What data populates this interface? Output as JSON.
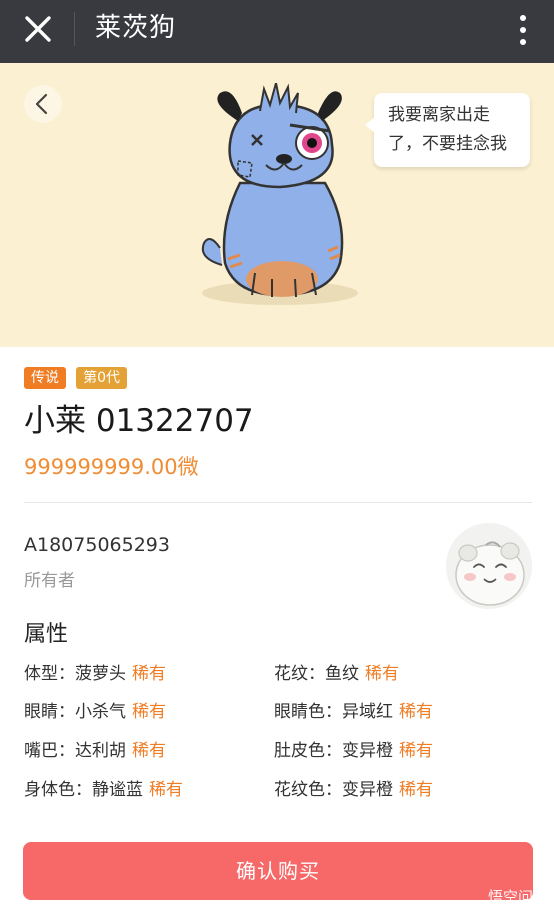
{
  "appbar": {
    "title": "莱茨狗",
    "close_icon": "close-icon",
    "more_icon": "more-vertical-icon"
  },
  "hero": {
    "bubble_text": "我要离家出走了，不要挂念我",
    "back_icon": "chevron-left-icon"
  },
  "pet": {
    "badges": [
      "传说",
      "第0代"
    ],
    "name": "小莱 01322707",
    "price": "999999999.00微"
  },
  "owner": {
    "id": "A18075065293",
    "label": "所有者"
  },
  "attributes": {
    "title": "属性",
    "rare_label": "稀有",
    "items": [
      {
        "label": "体型：菠萝头",
        "tag": "稀有"
      },
      {
        "label": "花纹：鱼纹",
        "tag": "稀有"
      },
      {
        "label": "眼睛：小杀气",
        "tag": "稀有"
      },
      {
        "label": "眼睛色：异域红",
        "tag": "稀有"
      },
      {
        "label": "嘴巴：达利胡",
        "tag": "稀有"
      },
      {
        "label": "肚皮色：变异橙",
        "tag": "稀有"
      },
      {
        "label": "身体色：静谧蓝",
        "tag": "稀有"
      },
      {
        "label": "花纹色：变异橙",
        "tag": "稀有"
      }
    ]
  },
  "actions": {
    "buy_label": "确认购买"
  },
  "watermark": "悟空问答",
  "colors": {
    "accent_orange": "#f07c24",
    "buy_button": "#f76868",
    "hero_bg": "#fcf0d2",
    "appbar_bg": "#393a3f"
  }
}
